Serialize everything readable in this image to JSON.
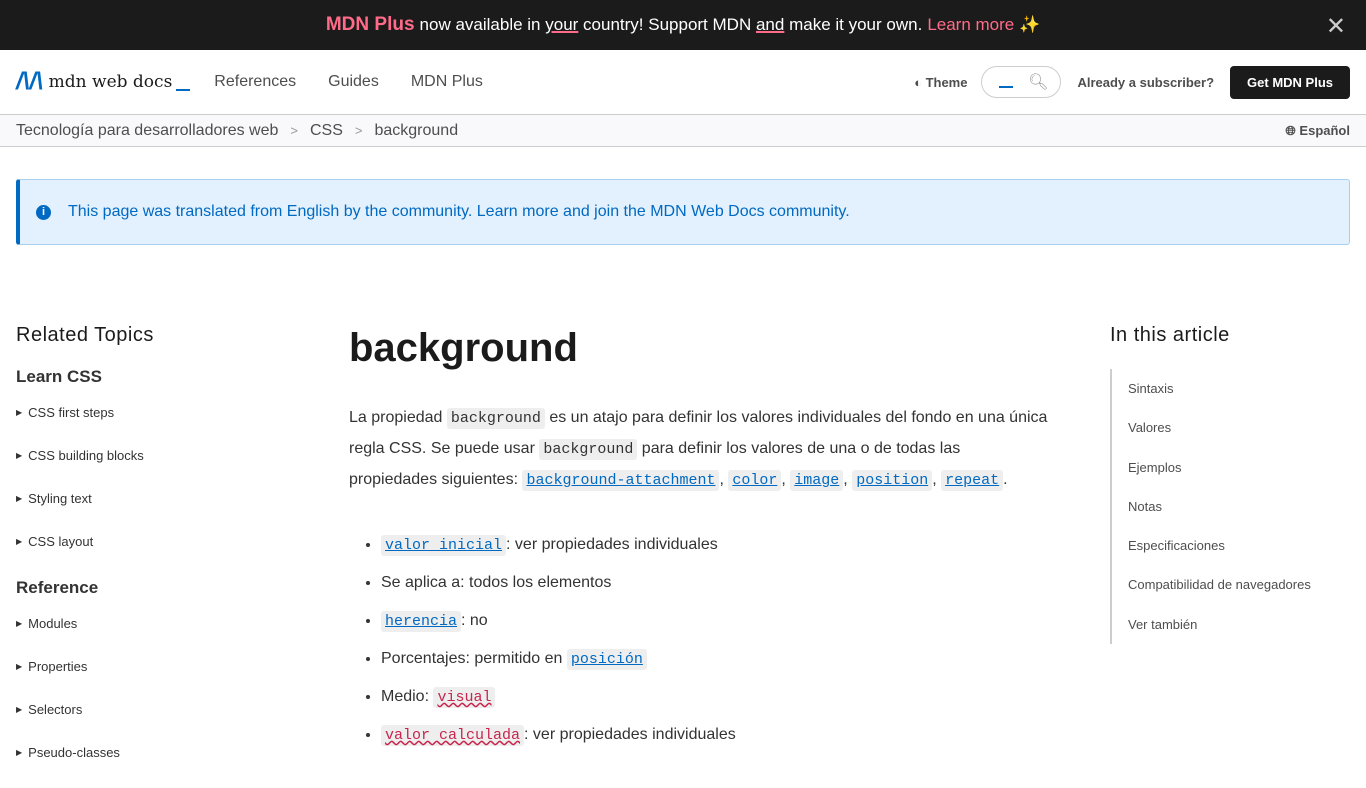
{
  "banner": {
    "brand": "MDN Plus",
    "t1": "now available in ",
    "your": "your",
    "t2": " country! Support MDN ",
    "and": "and",
    "t3": " make it your own.",
    "learn": "Learn more",
    "sparkle": "✨",
    "close": "✕"
  },
  "nav": {
    "logo": "mdn web docs",
    "items": [
      "References",
      "Guides",
      "MDN Plus"
    ],
    "theme": "Theme",
    "subscriber": "Already a subscriber?",
    "get_plus": "Get MDN Plus"
  },
  "breadcrumb": [
    "Tecnología para desarrolladores web",
    "CSS",
    "background"
  ],
  "language": "Español",
  "notice": "This page was translated from English by the community. Learn more and join the MDN Web Docs community.",
  "sidebar": {
    "title": "Related Topics",
    "sections": [
      {
        "title": "Learn CSS",
        "items": [
          "CSS first steps",
          "CSS building blocks",
          "Styling text",
          "CSS layout"
        ]
      },
      {
        "title": "Reference",
        "items": [
          "Modules",
          "Properties",
          "Selectors",
          "Pseudo-classes"
        ]
      }
    ]
  },
  "article": {
    "title": "background",
    "p1": "La propiedad ",
    "c1": "background",
    "p2": " es un atajo para definir los valores individuales del fondo en una única regla CSS. Se puede usar ",
    "c2": "background",
    "p3": " para definir los valores de una o de todas las propiedades siguientes: ",
    "links": [
      "background-attachment",
      "color",
      "image",
      "position",
      "repeat"
    ],
    "li": {
      "l1": "valor inicial",
      "t1": ": ver propiedades individuales",
      "t2": "Se aplica a: todos los elementos",
      "l3": "herencia",
      "t3": ": no",
      "t4": "Porcentajes: permitido en ",
      "l4": "posición",
      "t5": "Medio: ",
      "l5": "visual",
      "l6": "valor calculada",
      "t6": ": ver propiedades individuales"
    }
  },
  "toc": {
    "title": "In this article",
    "items": [
      "Sintaxis",
      "Valores",
      "Ejemplos",
      "Notas",
      "Especificaciones",
      "Compatibilidad de navegadores",
      "Ver también"
    ]
  }
}
